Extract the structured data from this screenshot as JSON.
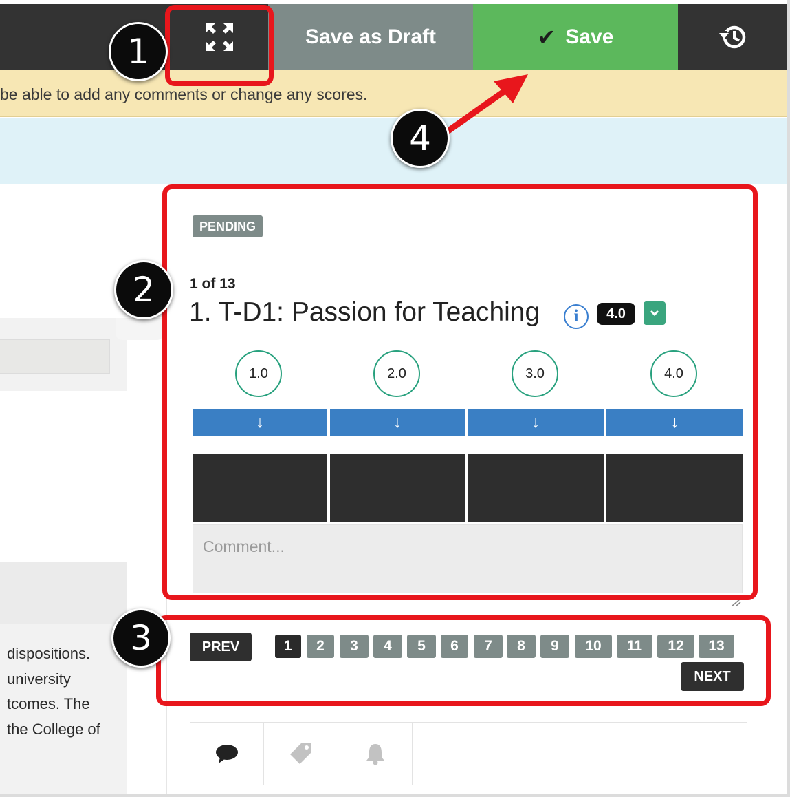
{
  "toolbar": {
    "expand_icon": "expand-icon",
    "save_draft_label": "Save as Draft",
    "save_label": "Save",
    "save_icon": "checkmark-icon",
    "history_icon": "history-icon"
  },
  "warning": {
    "text": "be able to add any comments or change any scores."
  },
  "left_panel": {
    "text_lines": [
      "dispositions.",
      "university",
      "tcomes. The",
      "the College of"
    ]
  },
  "criterion": {
    "status": "PENDING",
    "count": "1 of 13",
    "title": "1. T-D1: Passion for Teaching",
    "info_icon": "info-icon",
    "score": "4.0",
    "dropdown_icon": "chevron-down-icon"
  },
  "levels": [
    {
      "value": "1.0"
    },
    {
      "value": "2.0"
    },
    {
      "value": "3.0"
    },
    {
      "value": "4.0"
    }
  ],
  "level_select_icon": "arrow-down-icon",
  "comment": {
    "placeholder": "Comment..."
  },
  "pagination": {
    "prev_label": "PREV",
    "next_label": "NEXT",
    "pages": [
      "1",
      "2",
      "3",
      "4",
      "5",
      "6",
      "7",
      "8",
      "9",
      "10",
      "11",
      "12",
      "13"
    ],
    "active_page": "1"
  },
  "bottom_tabs": [
    {
      "icon": "comment-icon"
    },
    {
      "icon": "tag-icon"
    },
    {
      "icon": "bell-icon"
    }
  ],
  "annotations": [
    "1",
    "2",
    "3",
    "4"
  ],
  "colors": {
    "save_green": "#5cb85c",
    "draft_gray": "#7e8b89",
    "level_teal": "#28a17e",
    "level_bar_blue": "#3a7fc4",
    "warning_bg": "#f7e7b4",
    "annotation_red": "#e8161c"
  }
}
